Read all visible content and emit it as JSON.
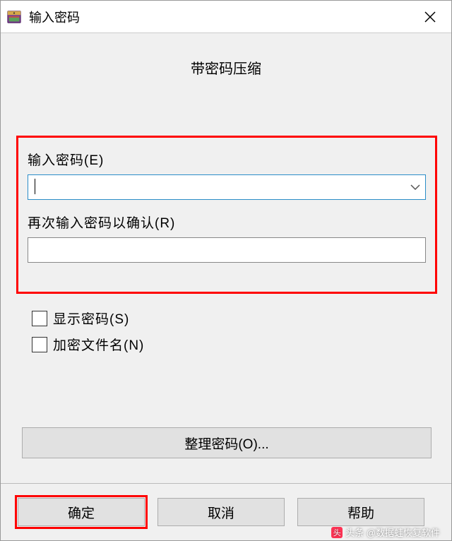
{
  "titlebar": {
    "title": "输入密码"
  },
  "content": {
    "header": "带密码压缩",
    "password_label": "输入密码(E)",
    "password_value": "",
    "confirm_label": "再次输入密码以确认(R)",
    "confirm_value": "",
    "show_password_label": "显示密码(S)",
    "encrypt_names_label": "加密文件名(N)",
    "organize_label": "整理密码(O)..."
  },
  "buttons": {
    "ok": "确定",
    "cancel": "取消",
    "help": "帮助"
  },
  "watermark": {
    "text": "头条 @数据蛙恢复软件"
  }
}
